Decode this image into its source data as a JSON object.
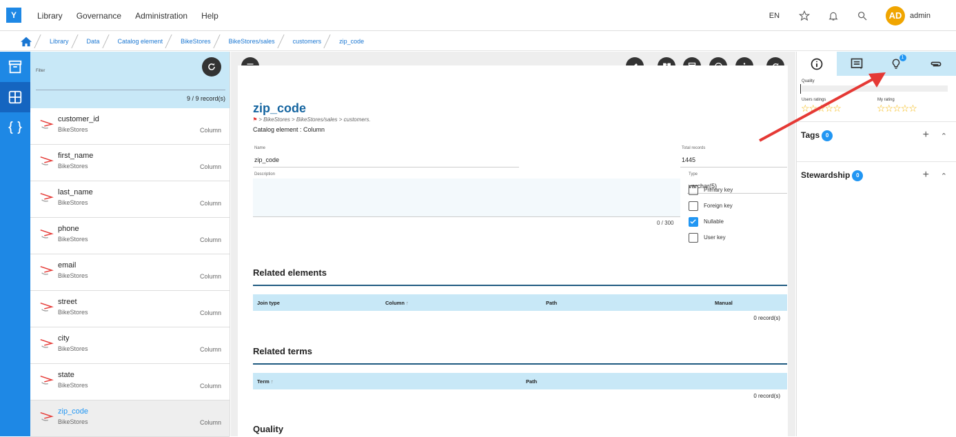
{
  "app": {
    "logo": "Y"
  },
  "topnav": [
    "Library",
    "Governance",
    "Administration",
    "Help"
  ],
  "topright": {
    "lang": "EN",
    "avatar": "AD",
    "user": "admin"
  },
  "breadcrumb": [
    "Library",
    "Data",
    "Catalog element",
    "BikeStores",
    "BikeStores/sales",
    "customers",
    "zip_code"
  ],
  "listpanel": {
    "filter_label": "Filter",
    "records": "9 / 9 record(s)",
    "items": [
      {
        "name": "customer_id",
        "sub": "BikeStores",
        "type": "Column"
      },
      {
        "name": "first_name",
        "sub": "BikeStores",
        "type": "Column"
      },
      {
        "name": "last_name",
        "sub": "BikeStores",
        "type": "Column"
      },
      {
        "name": "phone",
        "sub": "BikeStores",
        "type": "Column"
      },
      {
        "name": "email",
        "sub": "BikeStores",
        "type": "Column"
      },
      {
        "name": "street",
        "sub": "BikeStores",
        "type": "Column"
      },
      {
        "name": "city",
        "sub": "BikeStores",
        "type": "Column"
      },
      {
        "name": "state",
        "sub": "BikeStores",
        "type": "Column"
      },
      {
        "name": "zip_code",
        "sub": "BikeStores",
        "type": "Column"
      }
    ]
  },
  "main": {
    "title": "zip_code",
    "path": "> BikeStores > BikeStores/sales > customers.",
    "catalog_element": "Catalog element : Column",
    "name_label": "Name",
    "name_value": "zip_code",
    "total_label": "Total records",
    "total_value": "1445",
    "description_label": "Description",
    "desc_count": "0 / 300",
    "type_label": "Type",
    "type_value": "varchar(5)",
    "checkboxes": [
      {
        "label": "Primary key",
        "checked": false
      },
      {
        "label": "Foreign key",
        "checked": false
      },
      {
        "label": "Nullable",
        "checked": true
      },
      {
        "label": "User key",
        "checked": false
      }
    ],
    "related_elements": {
      "title": "Related elements",
      "cols": [
        "Join type",
        "Column",
        "Path",
        "Manual"
      ],
      "count": "0 record(s)"
    },
    "related_terms": {
      "title": "Related terms",
      "cols": [
        "Term",
        "Path"
      ],
      "count": "0 record(s)"
    },
    "quality_title": "Quality"
  },
  "right": {
    "idea_badge": "1",
    "quality_label": "Quality",
    "users_ratings": "Users ratings",
    "my_rating": "My rating",
    "tags": {
      "title": "Tags",
      "count": "0"
    },
    "stewardship": {
      "title": "Stewardship",
      "count": "0"
    }
  },
  "colors": {
    "accent": "#1e88e5",
    "light": "#c8e8f7",
    "title": "#1565a0",
    "arrow": "#e53935"
  }
}
